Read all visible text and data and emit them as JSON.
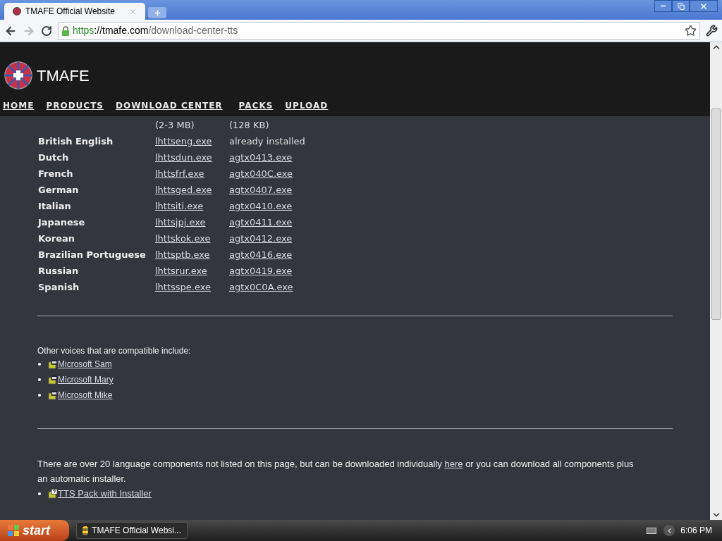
{
  "browser": {
    "tab_title": "TMAFE Official Website",
    "url_scheme": "https",
    "url_host": "://tmafe.com",
    "url_path": "/download-center-tts"
  },
  "site": {
    "logo_text": "TMAFE",
    "nav": [
      {
        "label": "HOME"
      },
      {
        "label": "PRODUCTS"
      },
      {
        "label": "DOWNLOAD CENTER"
      },
      {
        "label": "PACKS"
      },
      {
        "label": "UPLOAD"
      }
    ]
  },
  "table": {
    "columns": [
      "",
      "(2-3 MB)",
      "(128 KB)"
    ],
    "rows": [
      {
        "language": "British English",
        "file_1": "lhttseng.exe",
        "file_2": {
          "kind": "text",
          "text": "already installed"
        }
      },
      {
        "language": "Dutch",
        "file_1": "lhttsdun.exe",
        "file_2": {
          "kind": "link",
          "text": "agtx0413.exe"
        }
      },
      {
        "language": "French",
        "file_1": "lhttsfrf.exe",
        "file_2": {
          "kind": "link",
          "text": "agtx040C.exe"
        }
      },
      {
        "language": "German",
        "file_1": "lhttsged.exe",
        "file_2": {
          "kind": "link",
          "text": "agtx0407.exe"
        }
      },
      {
        "language": "Italian",
        "file_1": "lhttsiti.exe",
        "file_2": {
          "kind": "link",
          "text": "agtx0410.exe"
        }
      },
      {
        "language": "Japanese",
        "file_1": "lhttsjpj.exe",
        "file_2": {
          "kind": "link",
          "text": "agtx0411.exe"
        }
      },
      {
        "language": "Korean",
        "file_1": "lhttskok.exe",
        "file_2": {
          "kind": "link",
          "text": "agtx0412.exe"
        }
      },
      {
        "language": "Brazilian Portuguese",
        "file_1": "lhttsptb.exe",
        "file_2": {
          "kind": "link",
          "text": "agtx0416.exe"
        }
      },
      {
        "language": "Russian",
        "file_1": "lhttsrur.exe",
        "file_2": {
          "kind": "link",
          "text": "agtx0419.exe"
        }
      },
      {
        "language": "Spanish",
        "file_1": "lhttsspe.exe",
        "file_2": {
          "kind": "link",
          "text": "agtx0C0A.exe"
        }
      }
    ]
  },
  "voices": {
    "heading": "Other voices that are compatible include:",
    "items": [
      "Microsoft Sam",
      "Microsoft Mary",
      "Microsoft Mike"
    ]
  },
  "components": {
    "text_before": "There are over 20 language components not listed on this page, but can be downloaded individually",
    "link": "here",
    "text_after": "or you can download all components plus an automatic installer.",
    "items": [
      "TTS Pack with Installer"
    ]
  },
  "taskbar": {
    "start": "start",
    "window": "TMAFE Official Websi...",
    "clock": "6:06 PM"
  }
}
